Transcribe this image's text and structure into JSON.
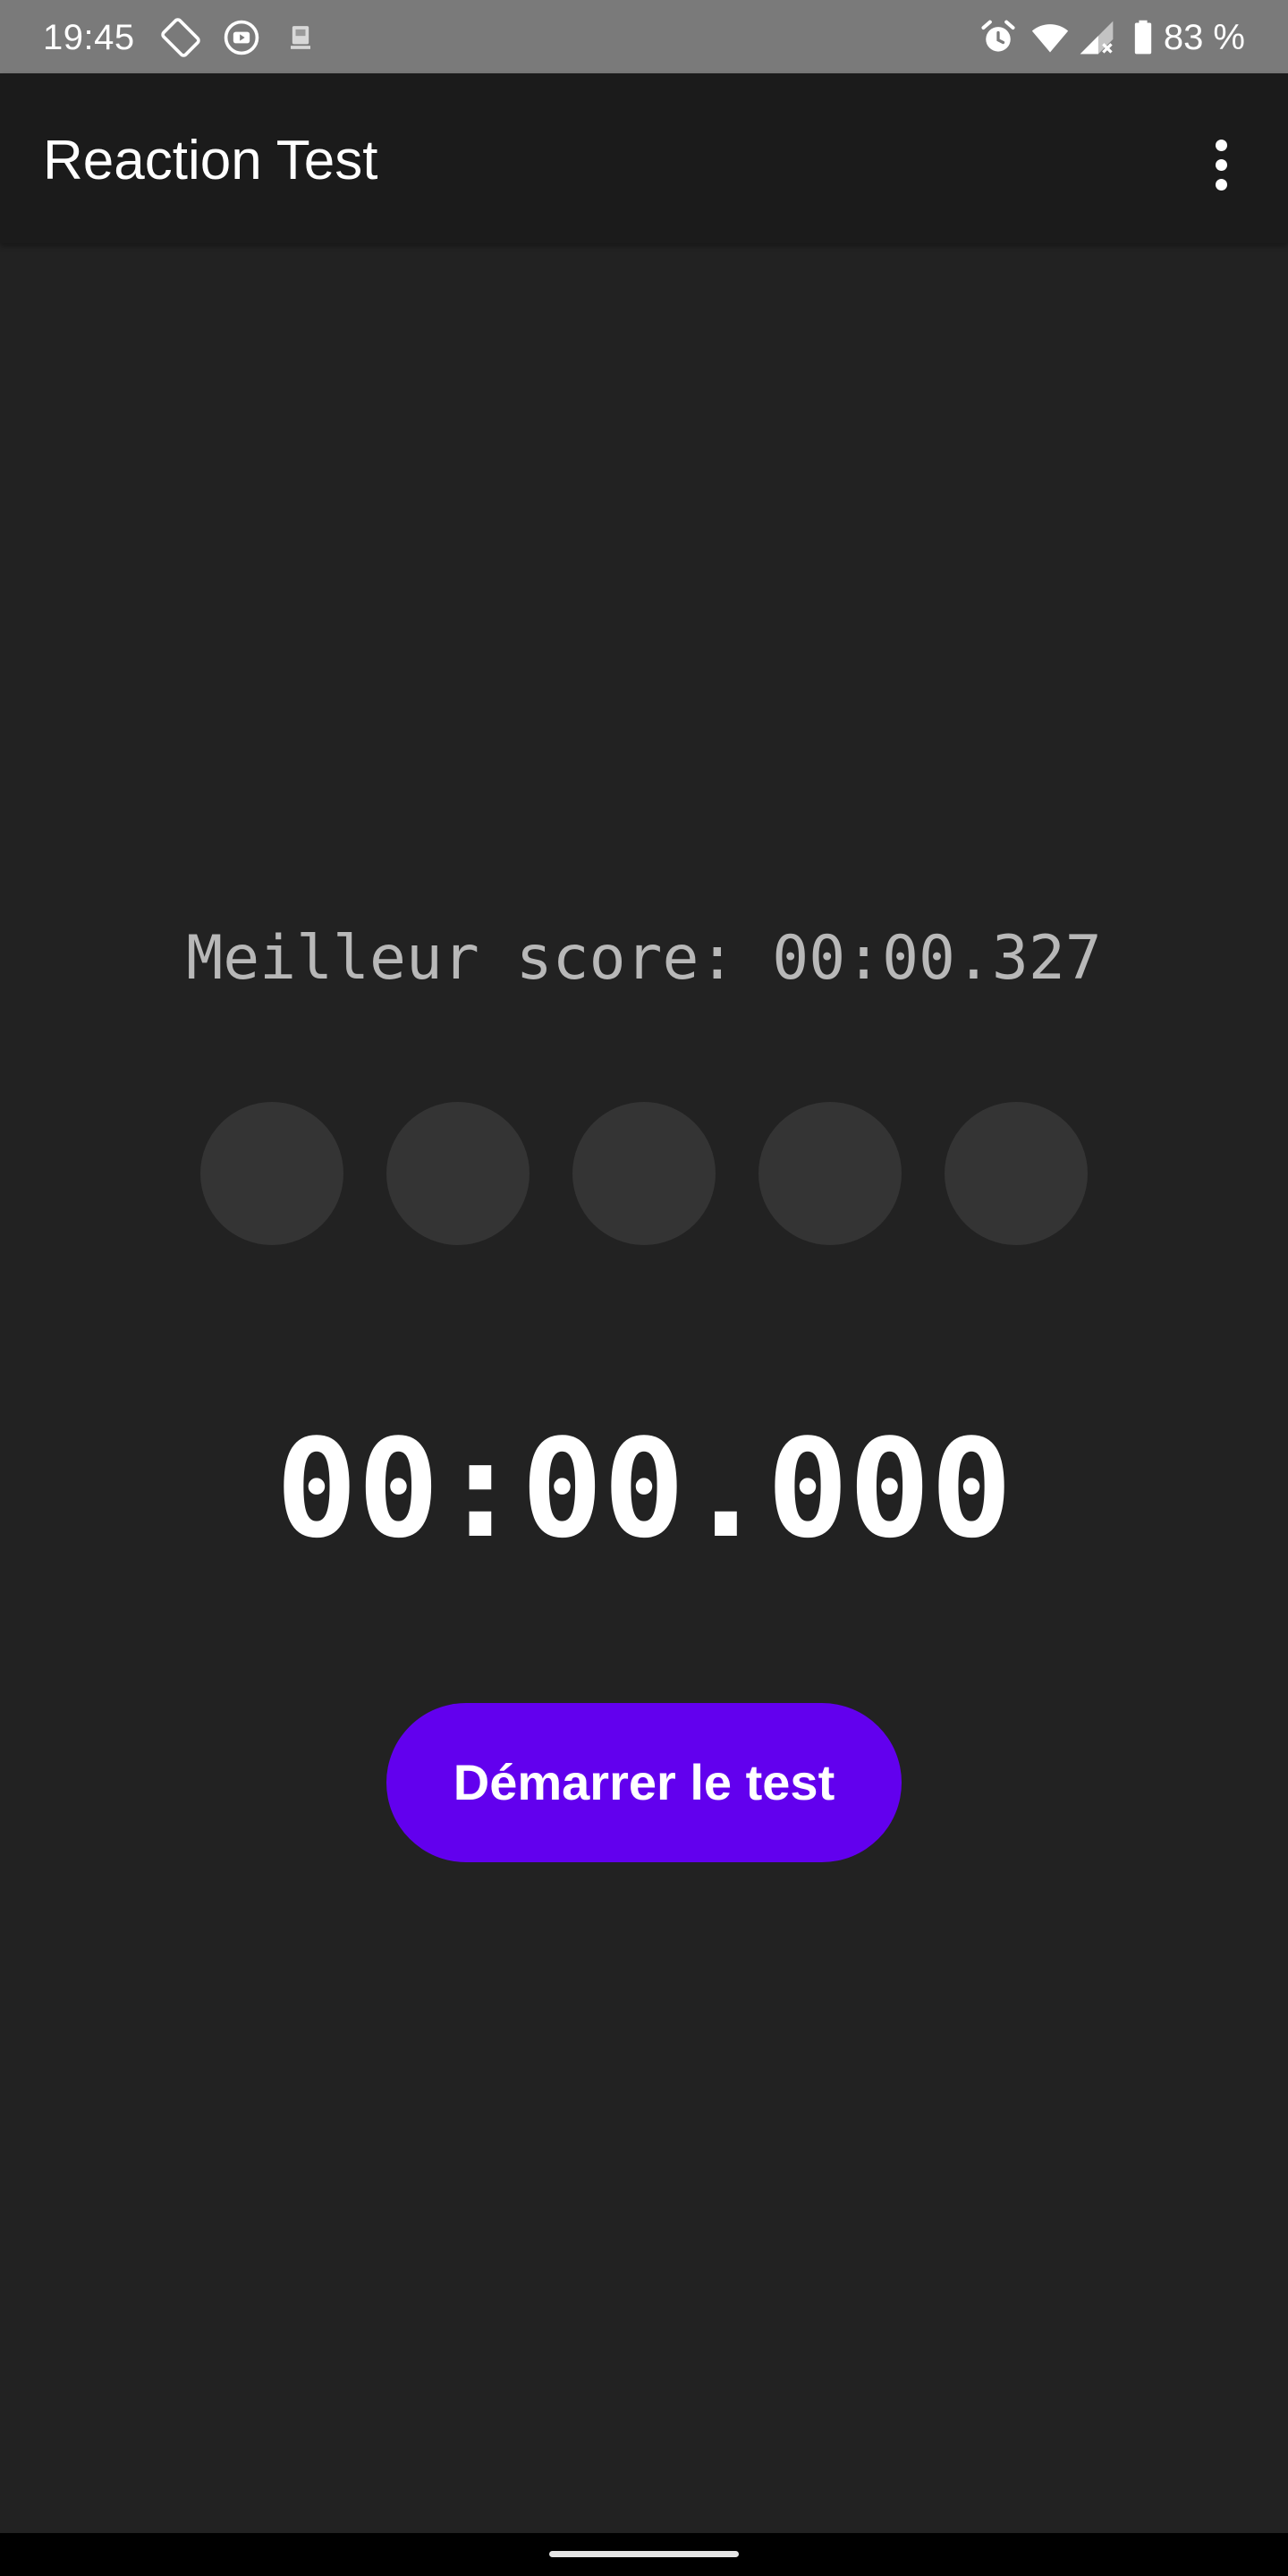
{
  "status_bar": {
    "time": "19:45",
    "left_icons": [
      "screen-rotate-icon",
      "youtube-icon",
      "system-notification-icon"
    ],
    "right_icons": [
      "alarm-icon",
      "wifi-icon",
      "cell-signal-no-data-icon",
      "battery-icon"
    ],
    "battery_text": "83 %"
  },
  "app_bar": {
    "title": "Reaction Test",
    "menu_icon": "more-vert-icon"
  },
  "main": {
    "best_score": "Meilleur score: 00:00.327",
    "indicator_count": 5,
    "indicator_color": "#343434",
    "timer": "00:00.000",
    "start_button_label": "Démarrer le test"
  },
  "colors": {
    "background": "#222222",
    "app_bar": "#1b1b1b",
    "status_bar": "#7a7a7a",
    "accent": "#6200ee",
    "best_score_text": "#b8b8b8",
    "timer_text": "#ffffff"
  }
}
